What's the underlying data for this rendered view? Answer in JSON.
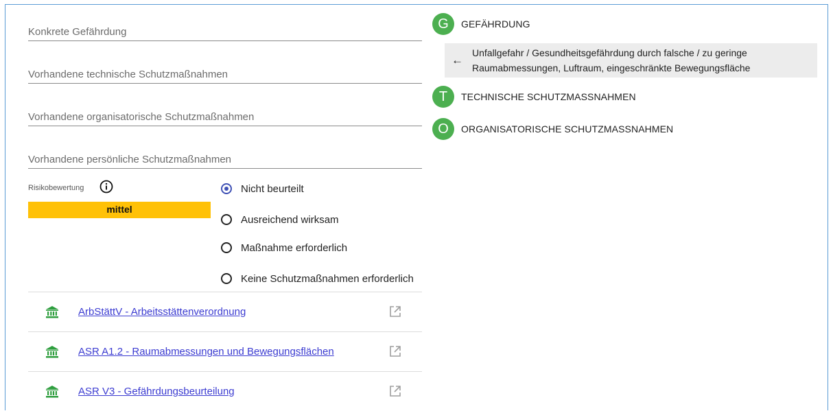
{
  "form": {
    "fields": [
      {
        "placeholder": "Konkrete Gefährdung",
        "value": ""
      },
      {
        "placeholder": "Vorhandene technische Schutzmaßnahmen",
        "value": ""
      },
      {
        "placeholder": "Vorhandene organisatorische Schutzmaßnahmen",
        "value": ""
      },
      {
        "placeholder": "Vorhandene persönliche Schutzmaßnahmen",
        "value": ""
      }
    ],
    "risk_label": "Risikobewertung",
    "risk_value": "mittel",
    "risk_color": "#ffc107",
    "radio_options": [
      {
        "label": "Nicht beurteilt",
        "selected": true
      },
      {
        "label": "Ausreichend wirksam",
        "selected": false
      },
      {
        "label": "Maßnahme erforderlich",
        "selected": false
      },
      {
        "label": "Keine Schutzmaßnahmen erforderlich",
        "selected": false
      }
    ]
  },
  "references": [
    {
      "icon": "bank-icon",
      "label": "ArbStättV - Arbeitsstättenverordnung",
      "action_icon": "open-external-icon"
    },
    {
      "icon": "bank-icon",
      "label": "ASR A1.2 - Raumabmessungen und Bewegungsflächen",
      "action_icon": "open-external-icon"
    },
    {
      "icon": "bank-icon",
      "label": "ASR V3 - Gefährdungsbeurteilung",
      "action_icon": "open-external-icon"
    }
  ],
  "sections": [
    {
      "badge": "G",
      "title": "GEFÄHRDUNG"
    },
    {
      "badge": "T",
      "title": "TECHNISCHE SCHUTZMASSNAHMEN"
    },
    {
      "badge": "O",
      "title": "ORGANISATORISCHE SCHUTZMASSNAHMEN"
    }
  ],
  "hazard_item": {
    "arrow": "←",
    "text": "Unfallgefahr / Gesundheitsgefährdung durch falsche / zu geringe Raumabmessungen, Luftraum, eingeschränkte Bewegungsfläche"
  },
  "colors": {
    "accent": "#3f51b5",
    "badge": "#4caf50",
    "icon_green": "#2e9e3e",
    "link": "#3b3bd1"
  }
}
